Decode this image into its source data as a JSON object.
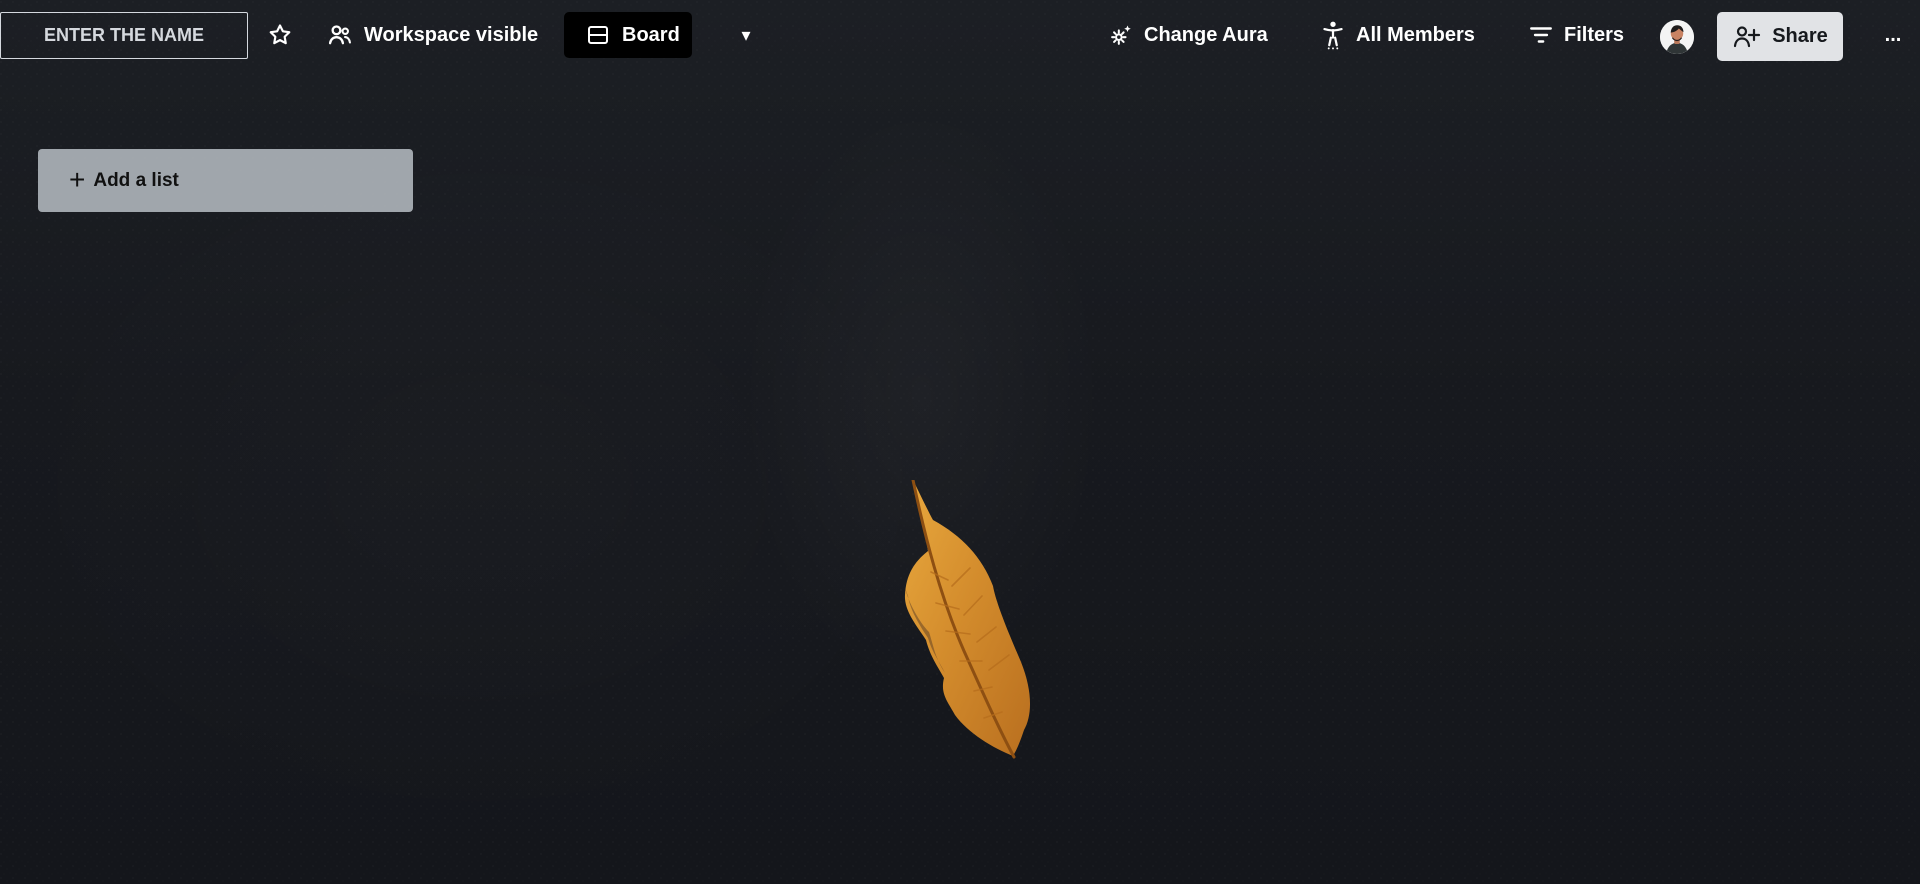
{
  "board": {
    "name_placeholder": "ENTER THE NAME",
    "workspace_label": "Workspace visible",
    "board_label": "Board",
    "dropdown_glyph": "▾",
    "change_aura_label": "Change Aura",
    "all_members_label": "All Members",
    "filters_label": "Filters",
    "share_label": "Share",
    "more_glyph": "...",
    "add_list_label": "Add a list",
    "add_list_glyph": "+"
  },
  "icons": {
    "star": "star-icon",
    "workspace": "people-icon",
    "board": "board-icon",
    "aura": "gear-sparkle-icon",
    "members": "accessibility-person-icon",
    "filters": "filter-icon",
    "share": "person-add-icon",
    "avatar": "user-avatar"
  },
  "colors": {
    "background": "#17191e",
    "active_tab": "#000000",
    "share_button": "#e1e3e6",
    "add_list": "#bec4ca",
    "leaf": "#d8942f"
  }
}
